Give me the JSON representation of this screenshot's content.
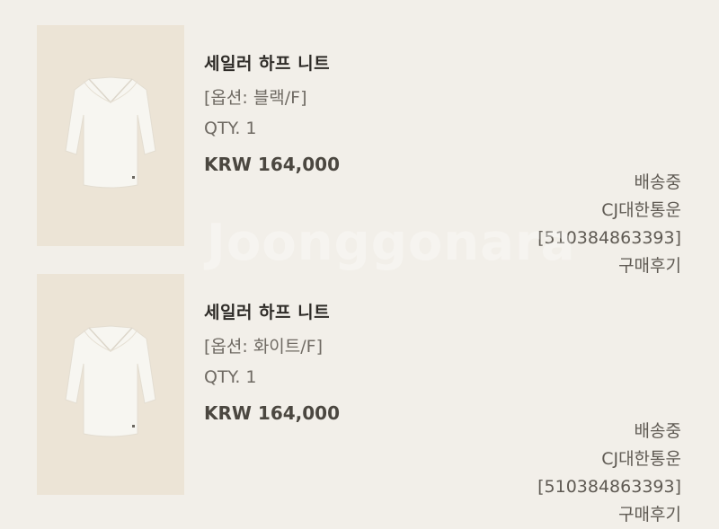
{
  "orders": [
    {
      "product_name": "세일러 하프 니트",
      "option": "[옵션: 블랙/F]",
      "quantity": "QTY. 1",
      "price": "KRW 164,000",
      "status": "배송중",
      "carrier": "CJ대한통운",
      "tracking_number": "[510384863393]",
      "review_link": "구매후기"
    },
    {
      "product_name": "세일러 하프 니트",
      "option": "[옵션: 화이트/F]",
      "quantity": "QTY. 1",
      "price": "KRW 164,000",
      "status": "배송중",
      "carrier": "CJ대한통운",
      "tracking_number": "[510384863393]",
      "review_link": "구매후기"
    }
  ],
  "watermark_text": "Joonggonara",
  "colors": {
    "background": "#f2efe9",
    "thumbnail_bg": "#ece4d6",
    "garment": "#f7f6f1"
  }
}
